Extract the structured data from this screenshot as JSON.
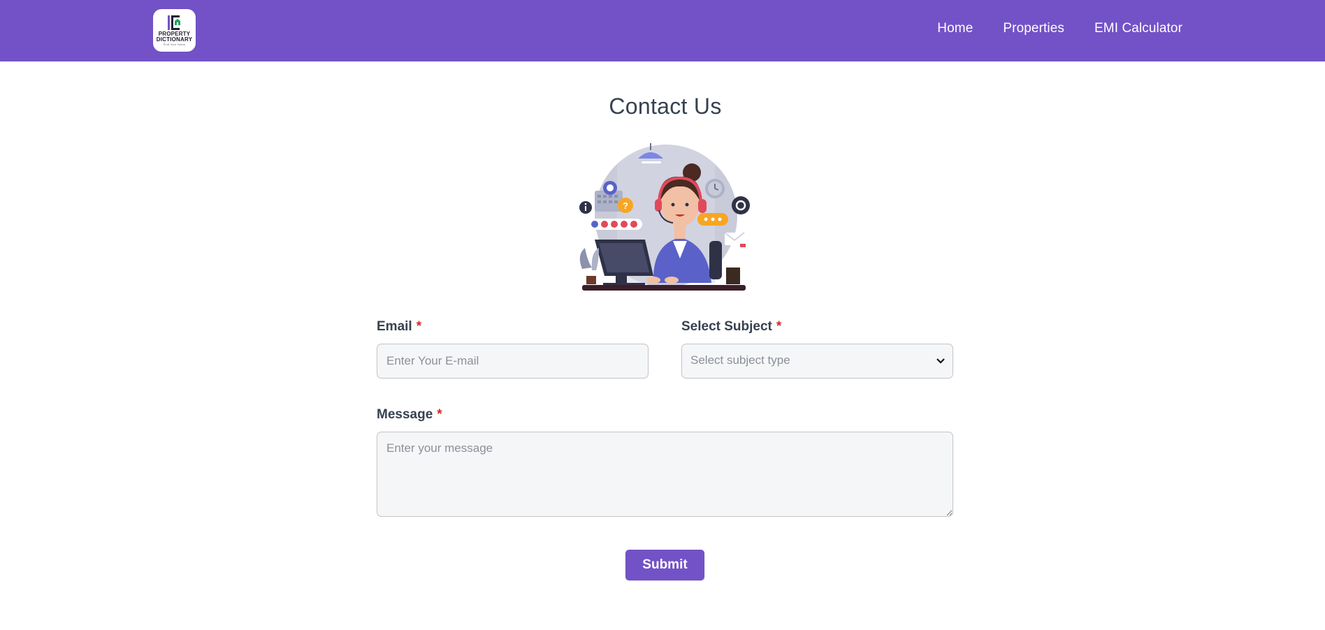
{
  "header": {
    "logo": {
      "line1": "PROPERTY",
      "line2": "DICTIONARY",
      "tagline": "Find Your Home"
    },
    "nav": [
      {
        "label": "Home"
      },
      {
        "label": "Properties"
      },
      {
        "label": "EMI Calculator"
      }
    ]
  },
  "page": {
    "title": "Contact Us",
    "illustration_icon": "customer-support-agent-illustration"
  },
  "form": {
    "email": {
      "label": "Email",
      "required_mark": "*",
      "placeholder": "Enter Your E-mail",
      "value": ""
    },
    "subject": {
      "label": "Select Subject",
      "required_mark": "*",
      "placeholder": "Select subject type",
      "selected": ""
    },
    "message": {
      "label": "Message",
      "required_mark": "*",
      "placeholder": "Enter your message",
      "value": ""
    },
    "submit_label": "Submit"
  },
  "colors": {
    "brand": "#7352c7",
    "required": "#dc2626",
    "field_bg": "#f5f6f8",
    "text": "#374151"
  }
}
